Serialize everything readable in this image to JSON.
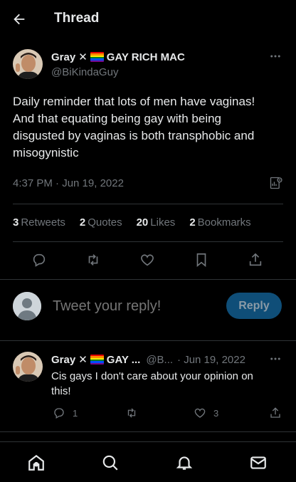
{
  "header": {
    "title": "Thread"
  },
  "tweet": {
    "name": "Gray",
    "name_suffix": "GAY RICH MAC",
    "handle": "@BiKindaGuy",
    "text_lines": [
      "Daily reminder that lots of men have vaginas!",
      "And that equating being gay with being",
      "disgusted by vaginas is both transphobic and",
      "misogynistic"
    ],
    "time": "4:37 PM · Jun 19, 2022",
    "stats": [
      {
        "count": "3",
        "label": "Retweets"
      },
      {
        "count": "2",
        "label": "Quotes"
      },
      {
        "count": "20",
        "label": "Likes"
      },
      {
        "count": "2",
        "label": "Bookmarks"
      }
    ]
  },
  "reply_box": {
    "placeholder": "Tweet your reply!",
    "button_label": "Reply"
  },
  "reply_tweet": {
    "name": "Gray",
    "name_suffix": "GAY ...",
    "handle": "@B...",
    "date": "· Jun 19, 2022",
    "text_lines": [
      "Cis gays I don't care about your opinion on",
      "this!"
    ],
    "reply_count": "1",
    "like_count": "3"
  },
  "colors": {
    "accent": "#1d9bf0",
    "reply_button": "#0f4e78",
    "muted": "#71767b",
    "divider": "#2f3336"
  },
  "icons": [
    "back-arrow-icon",
    "more-icon",
    "analytics-icon",
    "reply-icon",
    "retweet-icon",
    "like-icon",
    "bookmark-icon",
    "share-icon",
    "home-icon",
    "search-icon",
    "notifications-icon",
    "messages-icon"
  ]
}
